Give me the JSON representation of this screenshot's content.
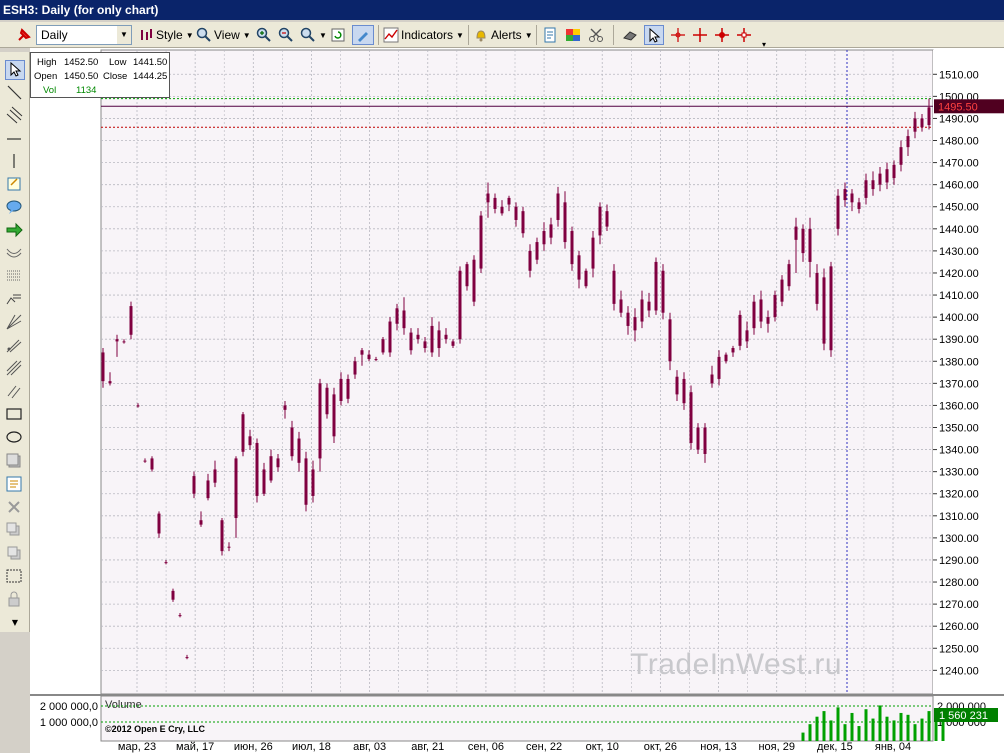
{
  "window": {
    "title": "ESH3: Daily (for only chart)"
  },
  "toolbar": {
    "interval_value": "Daily",
    "style_label": "Style",
    "view_label": "View",
    "indicators_label": "Indicators",
    "alerts_label": "Alerts"
  },
  "infobox": {
    "high_label": "High",
    "high_value": "1452.50",
    "low_label": "Low",
    "low_value": "1441.50",
    "open_label": "Open",
    "open_value": "1450.50",
    "close_label": "Close",
    "close_value": "1444.25",
    "vol_label": "Vol",
    "vol_value": "1134"
  },
  "volume_panel": {
    "title": "Volume",
    "copyright": "©2012 Open E Cry, LLC",
    "y_ticks": [
      "2 000 000,0",
      "1 000 000,0"
    ],
    "right_ticks": [
      "2 000 000",
      "1 000 000"
    ],
    "current_volume": "1 560 231"
  },
  "watermark": "TradeInWest.ru",
  "colors": {
    "candle": "#800040",
    "background": "#f8f4f8",
    "grid": "#b8b8c0",
    "price_marker": "#800000",
    "volume_bar": "#00a000"
  },
  "chart_data": {
    "type": "candlestick",
    "y_ticks": [
      1510,
      1500,
      1490,
      1480,
      1470,
      1460,
      1450,
      1440,
      1430,
      1420,
      1410,
      1400,
      1390,
      1380,
      1370,
      1360,
      1350,
      1340,
      1330,
      1320,
      1310,
      1300,
      1290,
      1280,
      1270,
      1260,
      1250,
      1240
    ],
    "y_tick_labels": [
      "1510.00",
      "1500.00",
      "1490.00",
      "1480.00",
      "1470.00",
      "1460.00",
      "1450.00",
      "1440.00",
      "1430.00",
      "1420.00",
      "1410.00",
      "1400.00",
      "1390.00",
      "1380.00",
      "1370.00",
      "1360.00",
      "1350.00",
      "1340.00",
      "1330.00",
      "1320.00",
      "1310.00",
      "1300.00",
      "1290.00",
      "1280.00",
      "1270.00",
      "1260.00",
      "1250.00",
      "1240.00"
    ],
    "ylim": [
      1232,
      1521
    ],
    "x_labels": [
      "мар, 23",
      "май, 17",
      "июн, 26",
      "июл, 18",
      "авг, 03",
      "авг, 21",
      "сен, 06",
      "сен, 22",
      "окт, 10",
      "окт, 26",
      "ноя, 13",
      "ноя, 29",
      "дек, 15",
      "янв, 04"
    ],
    "current_price": 1495.5,
    "current_price_label": "1495.50",
    "reference_levels": [
      1499,
      1486
    ],
    "candles": [
      [
        1386,
        1368,
        1371,
        1384
      ],
      [
        1375,
        1369,
        1370,
        1371
      ],
      [
        1392,
        1382,
        1389,
        1390
      ],
      [
        1390,
        1388,
        1389,
        1389
      ],
      [
        1407,
        1390,
        1405,
        1392
      ],
      [
        1361,
        1359,
        1360,
        1360
      ],
      [
        1336,
        1334,
        1335,
        1335
      ],
      [
        1337,
        1330,
        1336,
        1331
      ],
      [
        1312,
        1300,
        1311,
        1302
      ],
      [
        1290,
        1288,
        1289,
        1289
      ],
      [
        1277,
        1271,
        1276,
        1272
      ],
      [
        1266,
        1264,
        1265,
        1265
      ],
      [
        1247,
        1245,
        1246,
        1246
      ],
      [
        1330,
        1318,
        1328,
        1320
      ],
      [
        1312,
        1305,
        1308,
        1306
      ],
      [
        1329,
        1317,
        1326,
        1318
      ],
      [
        1335,
        1323,
        1331,
        1325
      ],
      [
        1309,
        1292,
        1308,
        1294
      ],
      [
        1298,
        1294,
        1296,
        1296
      ],
      [
        1337,
        1300,
        1309,
        1336
      ],
      [
        1357,
        1337,
        1356,
        1339
      ],
      [
        1349,
        1340,
        1342,
        1346
      ],
      [
        1345,
        1316,
        1343,
        1319
      ],
      [
        1334,
        1319,
        1331,
        1320
      ],
      [
        1340,
        1325,
        1337,
        1326
      ],
      [
        1338,
        1330,
        1336,
        1332
      ],
      [
        1362,
        1354,
        1358,
        1360
      ],
      [
        1353,
        1335,
        1350,
        1337
      ],
      [
        1348,
        1330,
        1334,
        1345
      ],
      [
        1339,
        1312,
        1336,
        1315
      ],
      [
        1335,
        1316,
        1331,
        1319
      ],
      [
        1372,
        1330,
        1336,
        1370
      ],
      [
        1370,
        1354,
        1368,
        1356
      ],
      [
        1368,
        1343,
        1365,
        1346
      ],
      [
        1375,
        1360,
        1372,
        1362
      ],
      [
        1374,
        1361,
        1363,
        1372
      ],
      [
        1382,
        1372,
        1374,
        1380
      ],
      [
        1386,
        1378,
        1383,
        1385
      ],
      [
        1385,
        1380,
        1381,
        1383
      ],
      [
        1382,
        1380,
        1381,
        1381
      ],
      [
        1391,
        1383,
        1390,
        1384
      ],
      [
        1400,
        1382,
        1398,
        1384
      ],
      [
        1406,
        1394,
        1397,
        1404
      ],
      [
        1409,
        1392,
        1403,
        1395
      ],
      [
        1395,
        1383,
        1393,
        1385
      ],
      [
        1395,
        1388,
        1392,
        1390
      ],
      [
        1391,
        1384,
        1386,
        1389
      ],
      [
        1400,
        1382,
        1396,
        1384
      ],
      [
        1398,
        1382,
        1394,
        1386
      ],
      [
        1395,
        1388,
        1392,
        1390
      ],
      [
        1390,
        1386,
        1389,
        1387
      ],
      [
        1423,
        1388,
        1390,
        1421
      ],
      [
        1425,
        1412,
        1424,
        1414
      ],
      [
        1428,
        1405,
        1426,
        1407
      ],
      [
        1448,
        1420,
        1422,
        1446
      ],
      [
        1461,
        1445,
        1452,
        1456
      ],
      [
        1456,
        1447,
        1454,
        1449
      ],
      [
        1453,
        1446,
        1450,
        1447
      ],
      [
        1455,
        1448,
        1451,
        1454
      ],
      [
        1452,
        1441,
        1450,
        1444
      ],
      [
        1450,
        1436,
        1448,
        1438
      ],
      [
        1433,
        1418,
        1430,
        1421
      ],
      [
        1436,
        1424,
        1426,
        1434
      ],
      [
        1443,
        1430,
        1439,
        1433
      ],
      [
        1445,
        1433,
        1442,
        1436
      ],
      [
        1459,
        1441,
        1444,
        1456
      ],
      [
        1457,
        1431,
        1452,
        1434
      ],
      [
        1441,
        1421,
        1439,
        1424
      ],
      [
        1430,
        1413,
        1428,
        1417
      ],
      [
        1422,
        1413,
        1414,
        1421
      ],
      [
        1439,
        1418,
        1422,
        1436
      ],
      [
        1452,
        1433,
        1437,
        1450
      ],
      [
        1451,
        1439,
        1448,
        1441
      ],
      [
        1424,
        1403,
        1421,
        1406
      ],
      [
        1412,
        1400,
        1408,
        1402
      ],
      [
        1405,
        1392,
        1402,
        1396
      ],
      [
        1404,
        1389,
        1394,
        1400
      ],
      [
        1412,
        1395,
        1398,
        1408
      ],
      [
        1411,
        1400,
        1407,
        1403
      ],
      [
        1427,
        1401,
        1403,
        1425
      ],
      [
        1424,
        1399,
        1421,
        1402
      ],
      [
        1402,
        1376,
        1399,
        1380
      ],
      [
        1376,
        1362,
        1373,
        1365
      ],
      [
        1375,
        1358,
        1361,
        1372
      ],
      [
        1369,
        1340,
        1366,
        1343
      ],
      [
        1352,
        1338,
        1350,
        1340
      ],
      [
        1352,
        1334,
        1338,
        1350
      ],
      [
        1378,
        1368,
        1374,
        1370
      ],
      [
        1385,
        1369,
        1372,
        1382
      ],
      [
        1384,
        1379,
        1380,
        1383
      ],
      [
        1387,
        1382,
        1386,
        1384
      ],
      [
        1403,
        1385,
        1387,
        1401
      ],
      [
        1398,
        1386,
        1394,
        1389
      ],
      [
        1410,
        1392,
        1395,
        1407
      ],
      [
        1412,
        1395,
        1408,
        1398
      ],
      [
        1403,
        1393,
        1397,
        1400
      ],
      [
        1412,
        1398,
        1400,
        1410
      ],
      [
        1419,
        1405,
        1407,
        1417
      ],
      [
        1426,
        1412,
        1424,
        1414
      ],
      [
        1445,
        1420,
        1435,
        1441
      ],
      [
        1442,
        1425,
        1440,
        1429
      ],
      [
        1445,
        1418,
        1425,
        1440
      ],
      [
        1424,
        1403,
        1420,
        1406
      ],
      [
        1422,
        1385,
        1418,
        1388
      ],
      [
        1425,
        1382,
        1385,
        1423
      ],
      [
        1458,
        1437,
        1440,
        1455
      ],
      [
        1461,
        1450,
        1453,
        1458
      ],
      [
        1458,
        1448,
        1456,
        1452
      ],
      [
        1454,
        1447,
        1449,
        1452
      ],
      [
        1465,
        1451,
        1454,
        1462
      ],
      [
        1466,
        1455,
        1462,
        1458
      ],
      [
        1468,
        1457,
        1460,
        1465
      ],
      [
        1470,
        1458,
        1467,
        1461
      ],
      [
        1471,
        1460,
        1463,
        1469
      ],
      [
        1480,
        1466,
        1469,
        1477
      ],
      [
        1485,
        1473,
        1477,
        1482
      ],
      [
        1493,
        1481,
        1484,
        1490
      ],
      [
        1492,
        1484,
        1490,
        1486
      ],
      [
        1499,
        1485,
        1487,
        1495
      ]
    ],
    "volume": [
      0,
      0,
      0,
      0,
      0,
      0,
      0,
      0,
      0,
      0,
      0,
      0,
      0,
      0,
      0,
      0,
      0,
      0,
      0,
      0,
      0,
      0,
      0,
      0,
      0,
      0,
      0,
      0,
      0,
      0,
      0,
      0,
      0,
      0,
      0,
      0,
      0,
      0,
      0,
      0,
      0,
      0,
      0,
      0,
      0,
      0,
      0,
      0,
      0,
      0,
      0,
      0,
      0,
      0,
      0,
      0,
      0,
      0,
      0,
      0,
      0,
      0,
      0,
      0,
      0,
      0,
      0,
      0,
      0,
      0,
      0,
      0,
      0,
      0,
      0,
      0,
      0,
      0,
      0,
      0,
      0,
      0,
      0,
      0,
      0,
      0,
      0,
      0,
      0,
      0,
      0,
      0,
      0,
      0,
      0,
      0,
      0,
      0,
      0,
      0,
      450000,
      900000,
      1300000,
      1600000,
      1100000,
      1800000,
      900000,
      1500000,
      800000,
      1700000,
      1200000,
      1900000,
      1300000,
      1100000,
      1500000,
      1400000,
      900000,
      1200000,
      1600000,
      1300000,
      1560231
    ]
  }
}
